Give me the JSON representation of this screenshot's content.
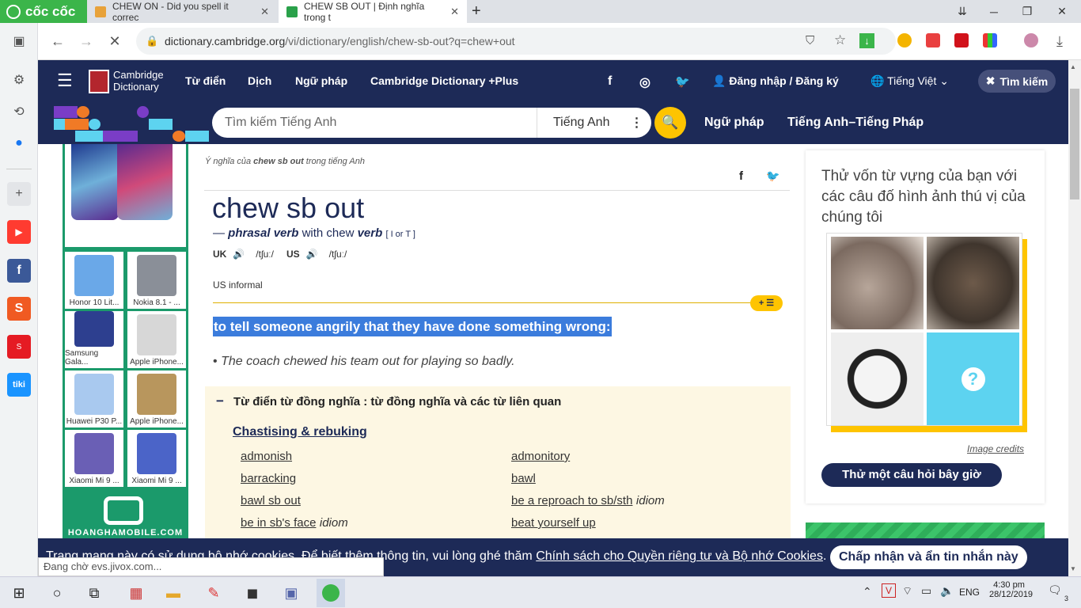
{
  "browser": {
    "name": "cốc cốc",
    "tabs": [
      {
        "title": "CHEW ON - Did you spell it correc"
      },
      {
        "title": "CHEW SB OUT | Định nghĩa trong t"
      }
    ],
    "new_tab": "+",
    "window_controls": {
      "minimize": "─",
      "restore": "❐",
      "close": "✕"
    },
    "url_host": "dictionary.cambridge.org",
    "url_path": "/vi/dictionary/english/chew-sb-out?q=chew+out",
    "status": "Đang chờ evs.jivox.com..."
  },
  "site": {
    "logo_line1": "Cambridge",
    "logo_line2": "Dictionary",
    "nav": [
      "Từ điển",
      "Dịch",
      "Ngữ pháp",
      "Cambridge Dictionary +Plus"
    ],
    "login": "Đăng nhập / Đăng ký",
    "language": "Tiếng Việt",
    "search_toggle": "Tìm kiếm",
    "search_placeholder": "Tìm kiếm Tiếng Anh",
    "search_lang": "Tiếng Anh",
    "sub_nav": [
      "Ngữ pháp",
      "Tiếng Anh–Tiếng Pháp"
    ]
  },
  "ads": {
    "phones": [
      {
        "label": "Honor 10 Lit...",
        "color": "#6aa8e8"
      },
      {
        "label": "Nokia 8.1 - ...",
        "color": "#8a8f98"
      },
      {
        "label": "Samsung Gala...",
        "color": "#2d3f8f"
      },
      {
        "label": "Apple iPhone...",
        "color": "#d7d7d7"
      },
      {
        "label": "Huawei P30 P...",
        "color": "#a9c9ef"
      },
      {
        "label": "Apple iPhone...",
        "color": "#b8965d"
      },
      {
        "label": "Xiaomi Mi 9 ...",
        "color": "#6a5fb5"
      },
      {
        "label": "Xiaomi Mi 9 ...",
        "color": "#4b64c8"
      }
    ],
    "brand": "HOANGHAMOBILE.COM"
  },
  "entry": {
    "breadcrumb_prefix": "Ý nghĩa của",
    "breadcrumb_word": "chew sb out",
    "breadcrumb_suffix": "trong tiếng Anh",
    "headword": "chew sb out",
    "pos_dash": "—",
    "pos": "phrasal verb",
    "pos_with": "with chew",
    "pos_verb": "verb",
    "grammar": "[ I or T ]",
    "uk": "UK",
    "uk_ipa": "/tʃuː/",
    "us": "US",
    "us_ipa": "/tʃuː/",
    "usage": "US informal",
    "definition": "to tell someone angrily that they have done something wrong:",
    "example": "The coach chewed his team out for playing so badly.",
    "bullet": "•",
    "thesaurus_title": "Từ điển từ đồng nghĩa : từ đồng nghĩa và các từ liên quan",
    "thesaurus_minus": "−",
    "thesaurus_group": "Chastising & rebuking",
    "synonyms_left": [
      {
        "word": "admonish",
        "tag": ""
      },
      {
        "word": "barracking",
        "tag": ""
      },
      {
        "word": "bawl sb out",
        "tag": ""
      },
      {
        "word": "be in sb's face",
        "tag": "idiom"
      }
    ],
    "synonyms_right": [
      {
        "word": "admonitory",
        "tag": ""
      },
      {
        "word": "bawl",
        "tag": ""
      },
      {
        "word": "be a reproach to sb/sth",
        "tag": "idiom"
      },
      {
        "word": "beat yourself up",
        "tag": ""
      }
    ]
  },
  "quiz": {
    "title": "Thử vốn từ vựng của bạn với các câu đố hình ảnh thú vị của chúng tôi",
    "credits": "Image credits",
    "button": "Thử một câu hỏi bây giờ",
    "question_mark": "?"
  },
  "cookie": {
    "text": "Trang mạng này có sử dụng bộ nhớ cookies. Để biết thêm thông tin, vui lòng ghé thăm",
    "link": "Chính sách cho Quyền riêng tư và Bộ nhớ Cookies",
    "period": ".",
    "accept": "Chấp nhận và ẩn tin nhắn này"
  },
  "taskbar": {
    "lang": "ENG",
    "time": "4:30 pm",
    "date": "28/12/2019",
    "notif_count": "3"
  },
  "colors": {
    "brand_navy": "#1d2a57",
    "accent_yellow": "#fec400",
    "browser_green": "#3bb54a",
    "highlight": "#3b7cdc"
  }
}
